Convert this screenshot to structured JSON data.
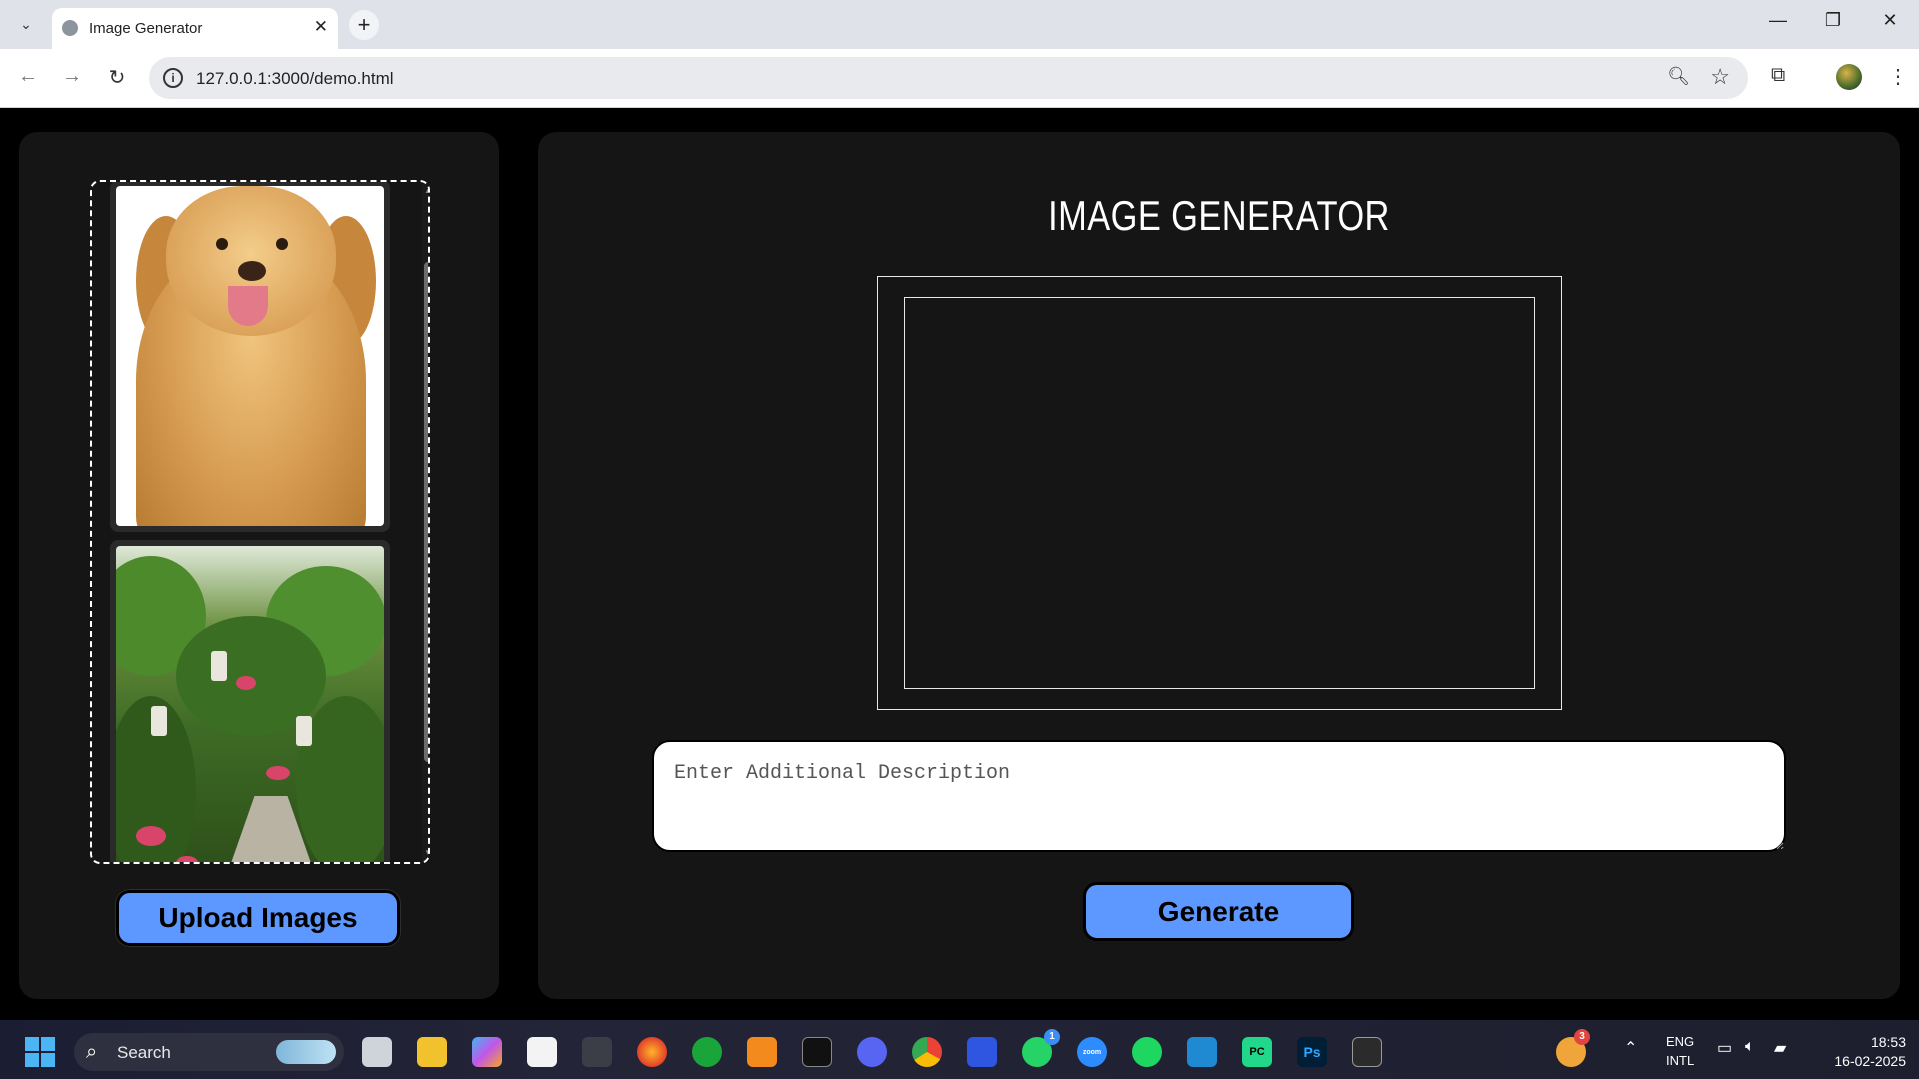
{
  "browser": {
    "tab_title": "Image Generator",
    "url": "127.0.0.1:3000/demo.html",
    "new_tab_label": "+",
    "close_tab_label": "✕"
  },
  "app": {
    "heading": "IMAGE GENERATOR",
    "description_placeholder": "Enter Additional Description",
    "description_value": "",
    "upload_button": "Upload Images",
    "generate_button": "Generate",
    "images": [
      {
        "subject": "golden retriever dog"
      },
      {
        "subject": "garden with lanterns"
      }
    ]
  },
  "taskbar": {
    "search_label": "Search",
    "lang_line1": "ENG",
    "lang_line2": "INTL",
    "time": "18:53",
    "date": "16-02-2025",
    "whatsapp_badge": "1",
    "weather_badge": "3",
    "apps": [
      "task-view",
      "file-explorer",
      "copilot",
      "microsoft-store",
      "unity",
      "firefox",
      "xbox",
      "sublime-text",
      "terminal",
      "discord",
      "chrome",
      "toggl",
      "whatsapp",
      "zoom",
      "spotify",
      "vscode",
      "pycharm",
      "photoshop",
      "powershell"
    ]
  }
}
